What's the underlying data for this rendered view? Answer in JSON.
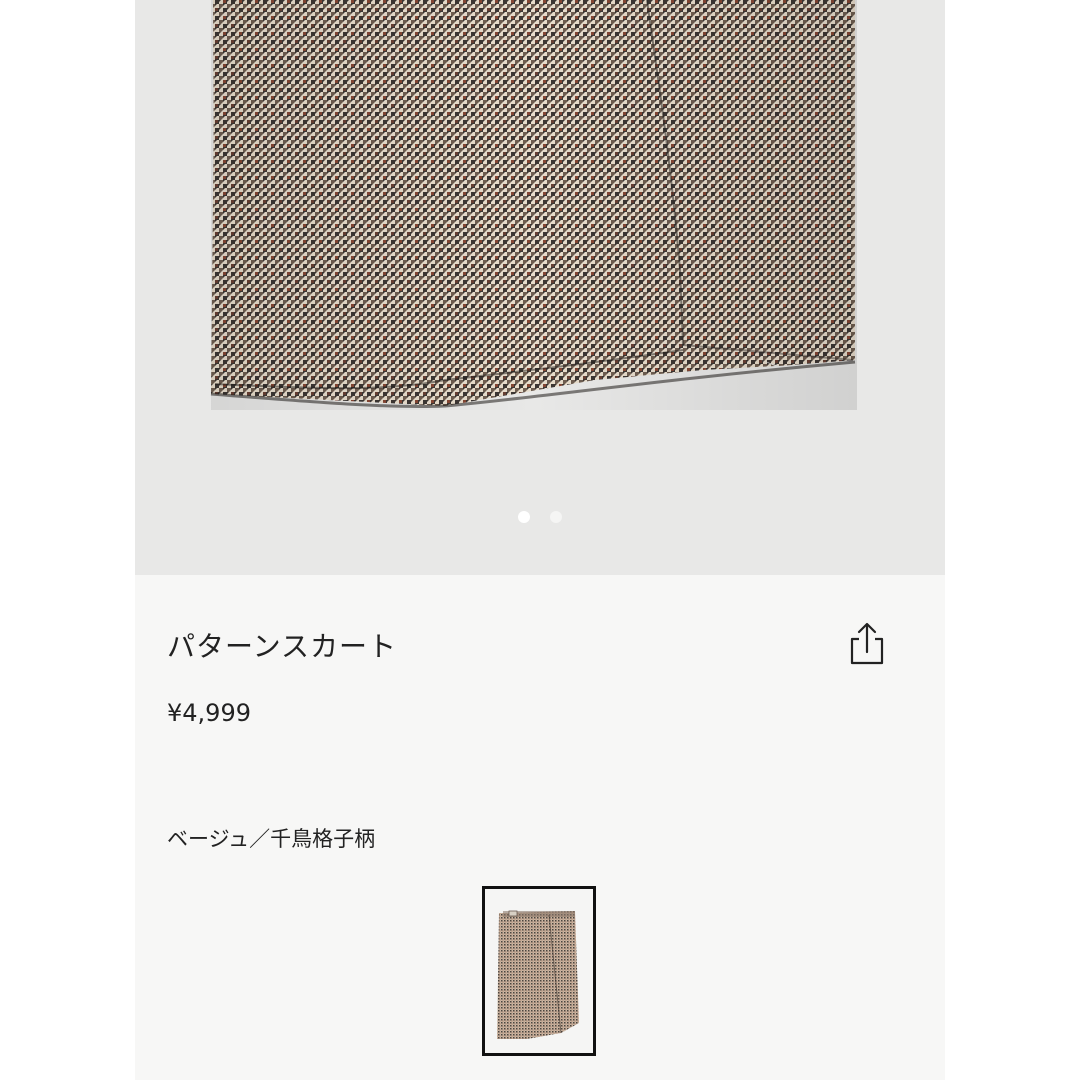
{
  "product": {
    "name": "パターンスカート",
    "price": "¥4,999",
    "color_name": "ベージュ／千鳥格子柄"
  },
  "gallery": {
    "image_count": 2,
    "active_index": 0
  },
  "icons": {
    "share": "share-icon"
  },
  "colors": {
    "page_background": "#f7f7f6",
    "image_background": "#e8e8e7",
    "text": "#222222",
    "swatch_border": "#111111",
    "fabric_base": "#e7dccb",
    "fabric_dark": "#3c3633",
    "fabric_rust": "#9c4a33"
  }
}
